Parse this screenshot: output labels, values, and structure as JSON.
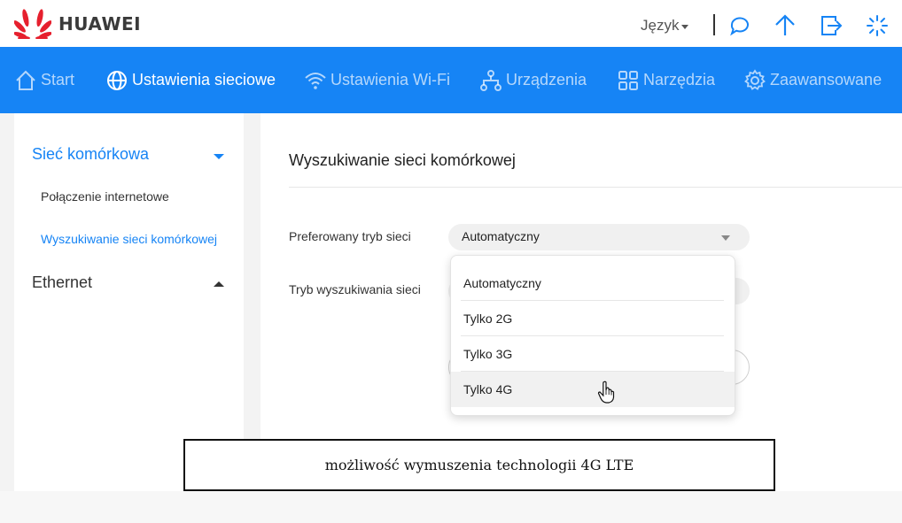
{
  "header": {
    "brand": "HUAWEI",
    "language_label": "Język",
    "icons": [
      "chat-icon",
      "upload-icon",
      "logout-icon",
      "loading-icon"
    ]
  },
  "nav": {
    "items": [
      {
        "label": "Start",
        "icon": "home-icon",
        "active": false
      },
      {
        "label": "Ustawienia sieciowe",
        "icon": "globe-icon",
        "active": true
      },
      {
        "label": "Ustawienia Wi-Fi",
        "icon": "wifi-icon",
        "active": false
      },
      {
        "label": "Urządzenia",
        "icon": "devices-icon",
        "active": false
      },
      {
        "label": "Narzędzia",
        "icon": "tools-icon",
        "active": false
      },
      {
        "label": "Zaawansowane",
        "icon": "gear-icon",
        "active": false
      }
    ]
  },
  "sidebar": {
    "groups": [
      {
        "label": "Sieć komórkowa",
        "expanded": true,
        "items": [
          "Połączenie internetowe",
          "Wyszukiwanie sieci komórkowej"
        ],
        "active_item": "Wyszukiwanie sieci komórkowej"
      },
      {
        "label": "Ethernet",
        "expanded": false
      }
    ]
  },
  "main": {
    "title": "Wyszukiwanie sieci komórkowej",
    "fields": [
      {
        "label": "Preferowany tryb sieci",
        "value": "Automatyczny"
      },
      {
        "label": "Tryb wyszukiwania sieci"
      }
    ],
    "dropdown": {
      "options": [
        "Automatyczny",
        "Tylko 2G",
        "Tylko 3G",
        "Tylko 4G"
      ],
      "hovered": "Tylko 4G"
    }
  },
  "caption": "możliwość wymuszenia technologii 4G LTE",
  "colors": {
    "accent": "#1684f5",
    "brand_red": "#e6202e"
  }
}
